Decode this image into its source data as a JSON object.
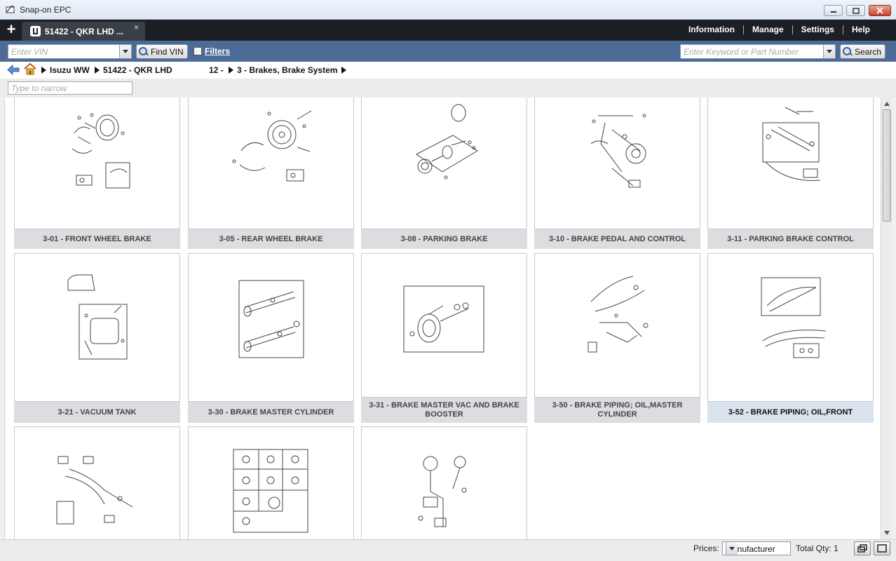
{
  "window": {
    "title": "Snap-on EPC"
  },
  "tabs": [
    {
      "label": "51422 - QKR LHD ...",
      "close": "×"
    }
  ],
  "new_tab": "+",
  "top_nav": [
    "Information",
    "Manage",
    "Settings",
    "Help"
  ],
  "toolbar": {
    "vin_placeholder": "Enter VIN",
    "find_vin_label": "Find VIN",
    "filters_label": "Filters",
    "keyword_placeholder": "Enter Keyword or Part Number",
    "search_label": "Search"
  },
  "breadcrumb": [
    "Isuzu WW",
    "51422 - QKR LHD",
    "12 -",
    "3 - Brakes, Brake System"
  ],
  "narrow_placeholder": "Type to narrow",
  "cards": [
    {
      "caption": "3-01 - FRONT WHEEL BRAKE"
    },
    {
      "caption": "3-05 - REAR WHEEL BRAKE"
    },
    {
      "caption": "3-08 - PARKING BRAKE"
    },
    {
      "caption": "3-10 - BRAKE PEDAL AND CONTROL"
    },
    {
      "caption": "3-11 - PARKING BRAKE CONTROL"
    },
    {
      "caption": "3-21 - VACUUM TANK"
    },
    {
      "caption": "3-30 - BRAKE MASTER CYLINDER"
    },
    {
      "caption": "3-31 - BRAKE MASTER VAC AND BRAKE BOOSTER"
    },
    {
      "caption": "3-50 - BRAKE PIPING; OIL,MASTER CYLINDER"
    },
    {
      "caption": "3-52 - BRAKE PIPING; OIL,FRONT"
    },
    {
      "caption": ""
    },
    {
      "caption": ""
    },
    {
      "caption": ""
    }
  ],
  "status": {
    "prices_label": "Prices:",
    "prices_value": "Manufacturer",
    "total_qty": "Total Qty: 1"
  },
  "colors": {
    "toolbar_blue": "#4c6b96",
    "tabstrip_dark": "#1c1f24",
    "caption_gray": "#dcdde0"
  }
}
